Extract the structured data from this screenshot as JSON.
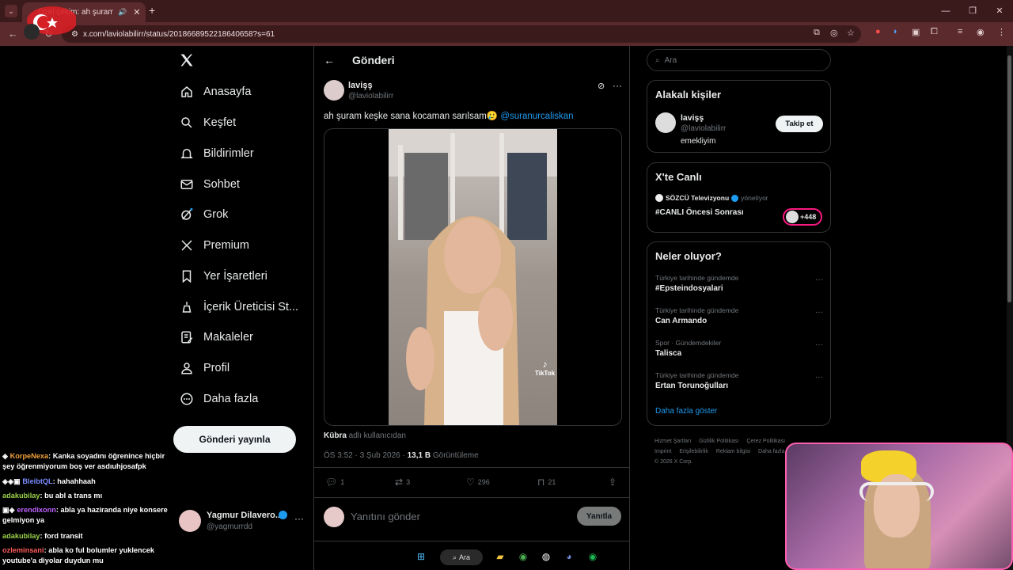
{
  "browser": {
    "tab_title": "Özel çekim: ah şuram keşke",
    "url": "x.com/laviolabilirr/status/2018668952218640658?s=61",
    "accent": "#5a2a2d"
  },
  "sidebar": {
    "items": [
      {
        "label": "Anasayfa",
        "icon": "home-icon"
      },
      {
        "label": "Keşfet",
        "icon": "search-icon"
      },
      {
        "label": "Bildirimler",
        "icon": "bell-icon"
      },
      {
        "label": "Sohbet",
        "icon": "mail-icon"
      },
      {
        "label": "Grok",
        "icon": "grok-icon"
      },
      {
        "label": "Premium",
        "icon": "x-icon"
      },
      {
        "label": "Yer İşaretleri",
        "icon": "bookmark-icon"
      },
      {
        "label": "İçerik Üreticisi St...",
        "icon": "creator-icon"
      },
      {
        "label": "Makaleler",
        "icon": "article-icon"
      },
      {
        "label": "Profil",
        "icon": "person-icon"
      },
      {
        "label": "Daha fazla",
        "icon": "more-circle-icon"
      }
    ],
    "post_button": "Gönderi yayınla",
    "account": {
      "name": "Yagmur Dilavero...",
      "handle": "@yagmurrdd"
    }
  },
  "chat": [
    {
      "user": "KorpeNexa",
      "color": "#f2a33a",
      "text": ": Kanka soyadını öğrenince hiçbir şey öğrenmiyorum boş ver asdıuhjosafpk"
    },
    {
      "user": "BleibtQL",
      "color": "#7a8cff",
      "text": ": hahahhaah"
    },
    {
      "user": "adakubilay",
      "color": "#9ad14b",
      "text": ": bu abl a trans mı"
    },
    {
      "user": "erendixonn",
      "color": "#c064ff",
      "text": ": abla ya haziranda niye konsere gelmiyon ya"
    },
    {
      "user": "adakubilay",
      "color": "#9ad14b",
      "text": ": ford transit"
    },
    {
      "user": "ozleminsani",
      "color": "#ff5b5b",
      "text": ": abla ko ful bolumler yuklencek youtube'a diyolar duydun mu"
    }
  ],
  "main": {
    "header_title": "Gönderi",
    "post": {
      "name": "lavişş",
      "handle": "@laviolabilirr",
      "text": "ah şuram keşke sana kocaman sarılsam🥲 ",
      "mention": "@suranurcaliskan",
      "tiktok_label": "TikTok",
      "credit_user": "Kübra",
      "credit_text": " adlı kullanıcıdan",
      "time": "ÖS 3:52 · 3 Şub 2026 · ",
      "views": "13,1 B",
      "views_label": " Görüntüleme",
      "replies": "1",
      "reposts": "3",
      "likes": "296",
      "bookmarks": "21"
    },
    "reply_placeholder": "Yanıtını gönder",
    "reply_button": "Yanıtla"
  },
  "right": {
    "search_placeholder": "Ara",
    "related": {
      "title": "Alakalı kişiler",
      "name": "lavişş",
      "handle": "@laviolabilirr",
      "bio": "emekliyim",
      "follow": "Takip et"
    },
    "live": {
      "title": "X'te Canlı",
      "host": "SÖZCÜ Televizyonu",
      "host_role": "yönetiyor",
      "show": "#CANLI Öncesi Sonrası",
      "count": "+448"
    },
    "trends": {
      "title": "Neler oluyor?",
      "items": [
        {
          "context": "Türkiye tarihinde gündemde",
          "name": "#Epsteindosyalari"
        },
        {
          "context": "Türkiye tarihinde gündemde",
          "name": "Can Armando"
        },
        {
          "context": "Spor · Gündemdekiler",
          "name": "Talisca"
        },
        {
          "context": "Türkiye tarihinde gündemde",
          "name": "Ertan Torunoğulları"
        }
      ],
      "show_more": "Daha fazla göster"
    },
    "footer": {
      "links": [
        "Hizmet Şartları",
        "Gizlilik Politikası",
        "Çerez Politikası",
        "Imprint",
        "Erişilebilirlik",
        "Reklam bilgisi",
        "Daha fazla..."
      ],
      "copyright": "© 2026 X Corp."
    }
  },
  "taskbar": {
    "search": "Ara"
  }
}
